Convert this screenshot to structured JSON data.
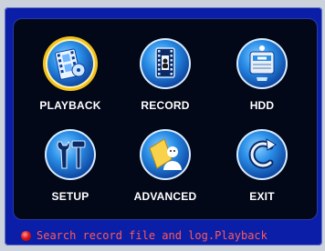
{
  "menu": {
    "items": [
      {
        "label": "PLAYBACK",
        "icon": "playback-film-icon",
        "selected": true
      },
      {
        "label": "RECORD",
        "icon": "record-film-icon",
        "selected": false
      },
      {
        "label": "HDD",
        "icon": "hdd-disk-icon",
        "selected": false
      },
      {
        "label": "SETUP",
        "icon": "setup-tools-icon",
        "selected": false
      },
      {
        "label": "ADVANCED",
        "icon": "advanced-user-icon",
        "selected": false
      },
      {
        "label": "EXIT",
        "icon": "exit-arrow-icon",
        "selected": false
      }
    ]
  },
  "status": {
    "text": "Search record file and log.Playback",
    "indicator": "red-dot-icon"
  },
  "colors": {
    "frame": "#0a1ea8",
    "panel": "#030818",
    "icon_blue": "#1e7fe0",
    "selected_ring": "#f3c21b",
    "status_text": "#ff5a5a"
  }
}
